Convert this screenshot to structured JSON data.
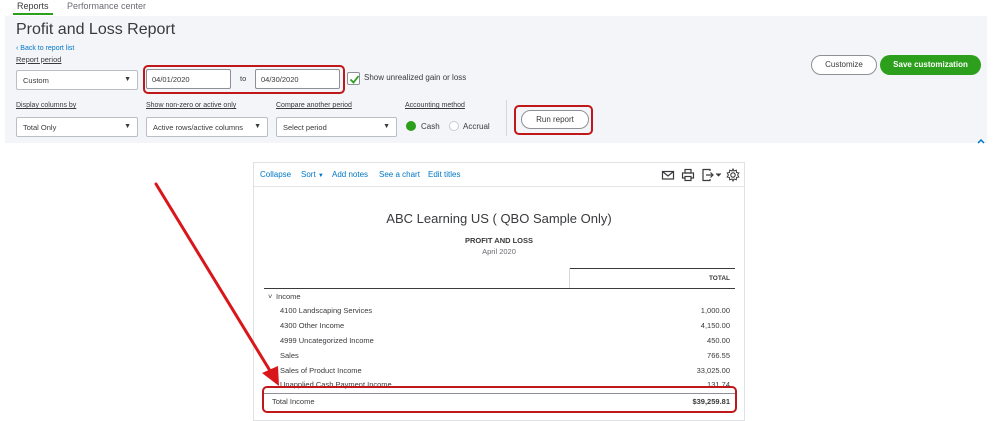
{
  "tabs": [
    {
      "label": "Reports",
      "active": true
    },
    {
      "label": "Performance center",
      "active": false
    }
  ],
  "header": {
    "title": "Profit and Loss Report",
    "back_link": "Back to report list",
    "report_period_label": "Report period",
    "report_period_value": "Custom",
    "date_from": "04/01/2020",
    "date_to_label": "to",
    "date_to": "04/30/2020",
    "unrealized_label": "Show unrealized gain or loss",
    "unrealized_checked": true,
    "display_columns_label": "Display columns by",
    "display_columns_value": "Total Only",
    "nonzero_label": "Show non-zero or active only",
    "nonzero_value": "Active rows/active columns",
    "compare_label": "Compare another period",
    "compare_value": "Select period",
    "accounting_label": "Accounting method",
    "accounting_options": [
      {
        "label": "Cash",
        "selected": true
      },
      {
        "label": "Accrual",
        "selected": false
      }
    ],
    "run_report": "Run report",
    "customize": "Customize",
    "save_customization": "Save customization"
  },
  "toolbar": {
    "collapse": "Collapse",
    "sort": "Sort",
    "add_notes": "Add notes",
    "see_chart": "See a chart",
    "edit_titles": "Edit titles",
    "icons": [
      "email-icon",
      "print-icon",
      "export-icon",
      "settings-gear-icon"
    ]
  },
  "report": {
    "company": "ABC Learning US ( QBO Sample Only)",
    "title": "PROFIT AND LOSS",
    "date": "April 2020",
    "column_header": "TOTAL",
    "section": "Income",
    "rows": [
      {
        "label": "4100 Landscaping Services",
        "value": "1,000.00"
      },
      {
        "label": "4300 Other Income",
        "value": "4,150.00"
      },
      {
        "label": "4999 Uncategorized Income",
        "value": "450.00"
      },
      {
        "label": "Sales",
        "value": "766.55"
      },
      {
        "label": "Sales of Product Income",
        "value": "33,025.00"
      },
      {
        "label": "Unapplied Cash Payment Income",
        "value": "131.74"
      }
    ],
    "total_label": "Total Income",
    "total_value": "$39,259.81"
  },
  "colors": {
    "accent_green": "#2ca01c",
    "link_blue": "#0077c5",
    "highlight_red": "#c0171b"
  }
}
